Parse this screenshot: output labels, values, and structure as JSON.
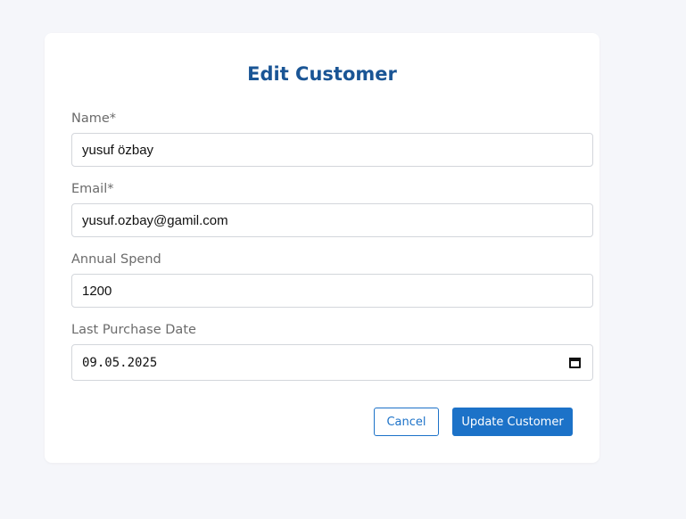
{
  "form": {
    "title": "Edit Customer",
    "fields": {
      "name": {
        "label": "Name*",
        "value": "yusuf özbay"
      },
      "email": {
        "label": "Email*",
        "value": "yusuf.ozbay@gamil.com"
      },
      "annual_spend": {
        "label": "Annual Spend",
        "value": "1200"
      },
      "last_purchase_date": {
        "label": "Last Purchase Date",
        "value": "09.05.2025",
        "icon": "calendar-icon"
      }
    },
    "buttons": {
      "cancel": "Cancel",
      "update": "Update Customer"
    }
  },
  "colors": {
    "background": "#f5f6fa",
    "card": "#ffffff",
    "title": "#1a5595",
    "accent": "#1c72c8"
  }
}
